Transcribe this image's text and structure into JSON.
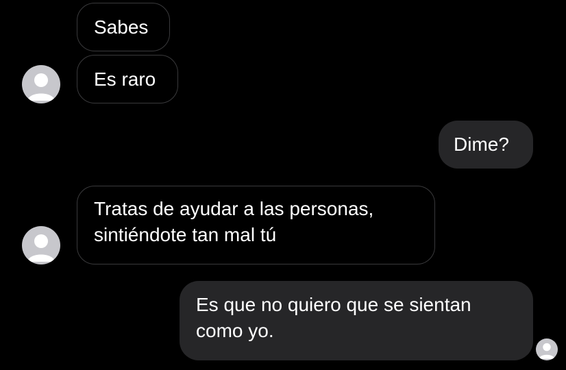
{
  "messages": [
    {
      "direction": "incoming",
      "text": "Sabes"
    },
    {
      "direction": "incoming",
      "text": "Es raro"
    },
    {
      "direction": "outgoing",
      "text": "Dime?"
    },
    {
      "direction": "incoming",
      "lines": [
        "Tratas de ayudar a las personas,",
        "sintiéndote tan mal tú"
      ]
    },
    {
      "direction": "outgoing",
      "lines": [
        "Es que no quiero que se sientan",
        "como yo."
      ]
    }
  ],
  "avatars": {
    "contact_icon": "default-avatar-icon",
    "read_receipt_icon": "default-avatar-icon"
  },
  "colors": {
    "background": "#000000",
    "incoming_border": "#3a3a3c",
    "outgoing_fill": "#262628",
    "avatar_bg": "#c7c7cc",
    "text": "#ffffff"
  }
}
